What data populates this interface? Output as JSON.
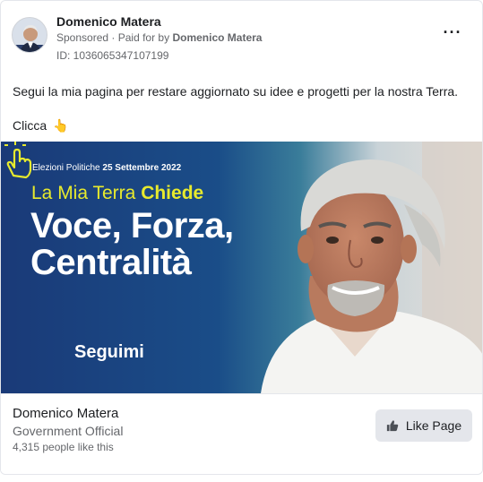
{
  "post": {
    "author": "Domenico Matera",
    "sponsored": "Sponsored",
    "paid_prefix": "Paid for by",
    "paid_by": "Domenico Matera",
    "ad_id": "ID: 1036065347107199",
    "more_icon": "ellipsis-icon",
    "text": "Segui la mia pagina per restare aggiornato su idee e progetti per la nostra Terra.",
    "cta_text": "Clicca",
    "cta_emoji": "👆"
  },
  "creative": {
    "date_prefix": "Elezioni Politiche",
    "date": "25 Settembre 2022",
    "line1_a": "La Mia Terra",
    "line1_b": "Chiede",
    "line2": "Voce, Forza,",
    "line3": "Centralità",
    "follow": "Seguimi",
    "accent_color": "#e7ea2d",
    "bg_color": "#1a3a78"
  },
  "footer": {
    "name": "Domenico Matera",
    "category": "Government Official",
    "likes": "4,315 people like this",
    "like_button": "Like Page"
  }
}
